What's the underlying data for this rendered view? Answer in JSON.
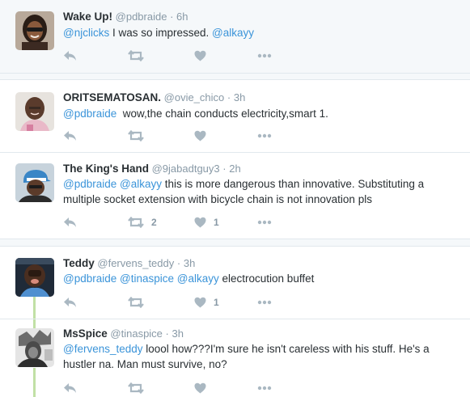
{
  "tweets": [
    {
      "name": "Wake Up!",
      "handle": "@pdbraide",
      "time": "6h",
      "mentions_prefix": "@njclicks",
      "text_middle": " I was so impressed. ",
      "mentions_suffix": "@alkayy",
      "retweets": "",
      "likes": ""
    },
    {
      "name": "ORITSEMATOSAN.",
      "handle": "@ovie_chico",
      "time": "3h",
      "mention1": "@pdbraide",
      "text": "  wow,the chain conducts electricity,smart 1.",
      "retweets": "",
      "likes": ""
    },
    {
      "name": "The King's Hand",
      "handle": "@9jabadtguy3",
      "time": "2h",
      "mention1": "@pdbraide",
      "mention2": "@alkayy",
      "text": " this is more dangerous than innovative. Substituting a multiple socket extension with bicycle chain is not innovation pls",
      "retweets": "2",
      "likes": "1"
    },
    {
      "name": "Teddy",
      "handle": "@fervens_teddy",
      "time": "3h",
      "mention1": "@pdbraide",
      "mention2": "@tinaspice",
      "mention3": "@alkayy",
      "text": " electrocution buffet",
      "retweets": "",
      "likes": "1"
    },
    {
      "name": "MsSpice",
      "handle": "@tinaspice",
      "time": "3h",
      "mention1": "@fervens_teddy",
      "text": " loool how???I'm sure he isn't careless with his stuff. He's a hustler na. Man must survive, no?",
      "retweets": "",
      "likes": ""
    }
  ],
  "separator": "·",
  "icons": {
    "reply": "reply-icon",
    "retweet": "retweet-icon",
    "like": "heart-icon",
    "more": "more-icon"
  },
  "colors": {
    "mention": "#3b94d9",
    "meta": "#8899a6",
    "action": "#aab8c2",
    "thread_active": "#c1e0a5",
    "background_shaded": "#f5f8fa"
  }
}
